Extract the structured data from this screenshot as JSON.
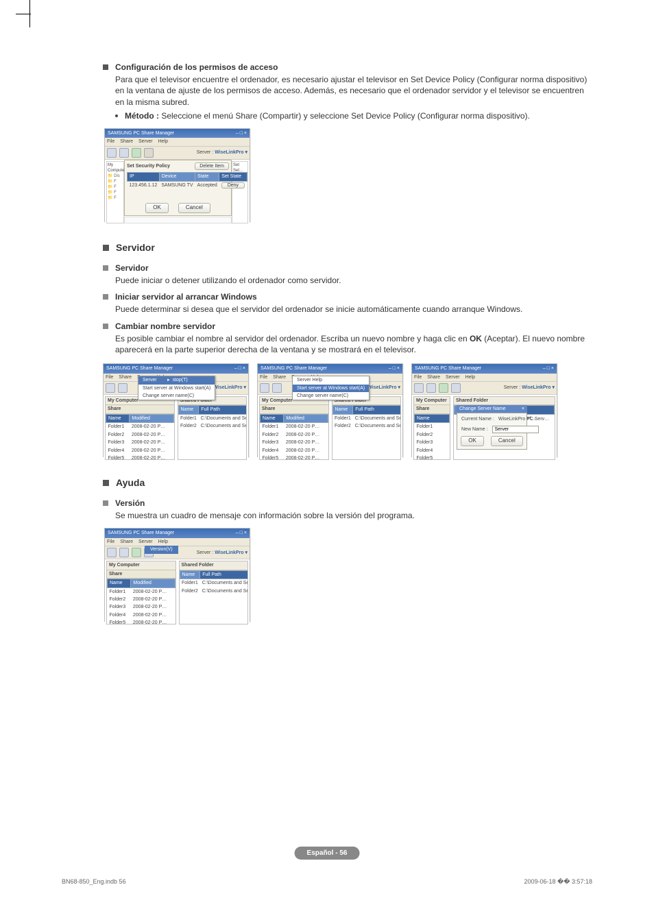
{
  "crop": true,
  "section1": {
    "heading": "Configuración de los permisos de acceso",
    "para": "Para que el televisor encuentre el ordenador, es necesario ajustar el televisor en Set Device Policy (Configurar norma dispositivo) en la ventana de ajuste de los permisos de acceso. Además, es necesario que el ordenador servidor y el televisor se encuentren en la misma subred.",
    "bullet_label": "Método :",
    "bullet_text": " Seleccione el menú Share (Compartir) y seleccione Set Device Policy (Configurar norma dispositivo)."
  },
  "win_common": {
    "title": "SAMSUNG PC Share Manager",
    "menus": [
      "File",
      "Share",
      "Server",
      "Help"
    ],
    "server_label": "Server :",
    "server_value": "WiseLinkPro  ▾",
    "left_head": "My Computer",
    "left_sub": "Share",
    "right_head": "Shared Folder",
    "cols_left": [
      "Name",
      "Modified"
    ],
    "cols_right": [
      "Name",
      "Full Path"
    ],
    "rows_left": [
      [
        "Folder1",
        "2008-02-20 P…"
      ],
      [
        "Folder2",
        "2008-02-20 P…"
      ],
      [
        "Folder3",
        "2008-02-20 P…"
      ],
      [
        "Folder4",
        "2008-02-20 P…"
      ],
      [
        "Folder5",
        "2008-02-20 P…"
      ]
    ],
    "rows_right": [
      [
        "Folder1",
        "C:\\Documents and Set…"
      ],
      [
        "Folder2",
        "C:\\Documents and Set…"
      ]
    ]
  },
  "policy": {
    "panel_title": "Set Security Policy",
    "delete_btn": "Delete Item",
    "cols": [
      "IP",
      "Device",
      "State",
      "Set State"
    ],
    "row": [
      "123.456.1.12",
      "SAMSUNG TV",
      "Accepted",
      "Deny"
    ],
    "side_items": [
      "Set",
      "Set…"
    ],
    "ok": "OK",
    "cancel": "Cancel"
  },
  "servidor": {
    "heading": "Servidor",
    "sub1": "Servidor",
    "sub1_text": "Puede iniciar o detener utilizando el ordenador como servidor.",
    "sub2": "Iniciar servidor al arrancar Windows",
    "sub2_text": "Puede determinar si desea que el servidor del ordenador se inicie automáticamente cuando arranque Windows.",
    "sub3": "Cambiar nombre servidor",
    "sub3_text": "Es posible cambiar el nombre al servidor del ordenador. Escriba un nuevo nombre y haga clic en OK (Aceptar). El nuevo nombre aparecerá en la parte superior derecha de la ventana y se mostrará en el televisor.",
    "ok_bold": "OK"
  },
  "menu_server": {
    "items": [
      "Server  Help",
      "Start server at Windows start(A)",
      "Change server name(C)"
    ],
    "highlight": "Change server name(C)",
    "top": "Server  Help",
    "sub1": "Start server at Windows start(A)",
    "sub2": "Change server name(C)"
  },
  "dialog_rename": {
    "title": "Change Server Name",
    "current_label": "Current Name :",
    "current_value": "WiseLinkPro PC Serv…",
    "new_label": "New Name  :",
    "new_value": "Server",
    "ok": "OK",
    "cancel": "Cancel"
  },
  "ayuda": {
    "heading": "Ayuda",
    "sub": "Versión",
    "text": "Se muestra un cuadro de mensaje con información sobre la versión del programa."
  },
  "page_pill": "Español - 56",
  "foot_left": "BN68-850_Eng.indb   56",
  "foot_right": "2009-06-18   �� 3:57:18"
}
